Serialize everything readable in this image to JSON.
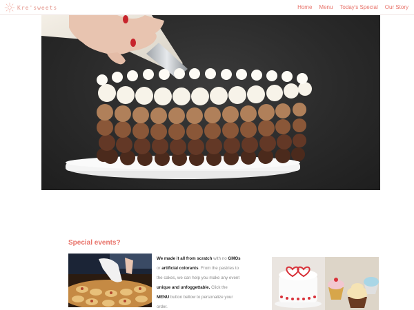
{
  "brand": {
    "name": "Kre'sweets"
  },
  "nav": {
    "items": [
      {
        "label": "Home"
      },
      {
        "label": "Menu"
      },
      {
        "label": "Today's Special"
      },
      {
        "label": "Our Story"
      }
    ]
  },
  "hero": {
    "image_subject": "ombre-cake-piping-photo"
  },
  "special_events": {
    "title": "Special events?",
    "text": {
      "p1_bold": "We made it all from scratch",
      "p2": " with no ",
      "p3_bold": "GMOs",
      "p4": " or ",
      "p5_bold": "artificial colorants",
      "p6": ". From the pastries to the cakes, we can help you make any event ",
      "p7_bold": "unique and unfoggettable.",
      "p8": " Click the ",
      "p9_bold": "MENU",
      "p10": " button bellow to personalize your order."
    }
  },
  "colors": {
    "accent": "#e8736a",
    "logo": "#e5998f",
    "text_muted": "#8a8a8a"
  }
}
